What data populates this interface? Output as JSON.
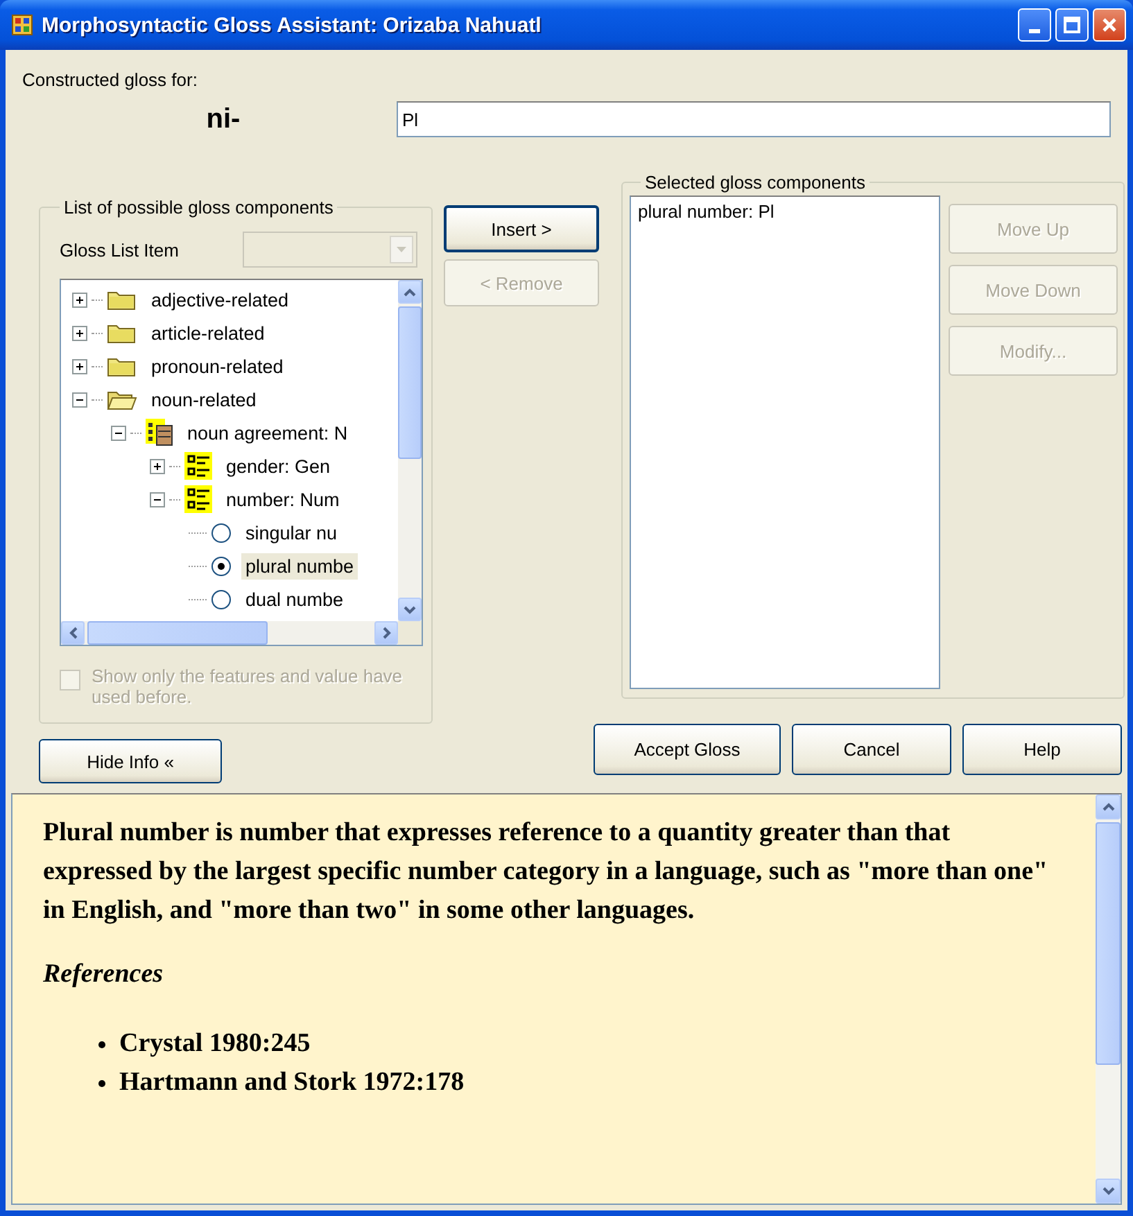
{
  "window": {
    "title": "Morphosyntactic Gloss Assistant: Orizaba Nahuatl"
  },
  "header": {
    "label": "Constructed gloss for:",
    "morpheme": "ni-",
    "gloss_value": "Pl"
  },
  "possible_components": {
    "title": "List of possible gloss components",
    "list_item_label": "Gloss List Item",
    "list_item_disabled": true,
    "tree": [
      {
        "kind": "folder",
        "label": "adjective-related",
        "expanded": false,
        "selected": false
      },
      {
        "kind": "folder",
        "label": "article-related",
        "expanded": false,
        "selected": false
      },
      {
        "kind": "folder",
        "label": "pronoun-related",
        "expanded": false,
        "selected": false
      },
      {
        "kind": "folder",
        "label": "noun-related",
        "expanded": true,
        "selected": false,
        "children": [
          {
            "kind": "group",
            "label": "noun agreement: N",
            "expanded": true,
            "selected": false,
            "children": [
              {
                "kind": "feature",
                "label": "gender: Gen",
                "expanded": false,
                "selected": false
              },
              {
                "kind": "feature",
                "label": "number: Num",
                "expanded": true,
                "selected": false,
                "children": [
                  {
                    "kind": "radio",
                    "label": "singular nu",
                    "selected": false
                  },
                  {
                    "kind": "radio",
                    "label": "plural numbe",
                    "selected": true
                  },
                  {
                    "kind": "radio",
                    "label": "dual numbe",
                    "selected": false
                  }
                ]
              }
            ]
          }
        ]
      }
    ],
    "filter_checkbox": {
      "label": "Show only the features and value have used before.",
      "checked": false,
      "disabled": true
    }
  },
  "transfer_buttons": [
    {
      "label": "Insert >",
      "disabled": false
    },
    {
      "label": "< Remove",
      "disabled": true
    }
  ],
  "selected_components": {
    "title": "Selected gloss components",
    "items": [
      "plural number: Pl"
    ],
    "buttons": [
      {
        "label": "Move Up",
        "disabled": true
      },
      {
        "label": "Move Down",
        "disabled": true
      },
      {
        "label": "Modify...",
        "disabled": true
      }
    ]
  },
  "hide_info_button": "Hide Info «",
  "dialog_buttons": [
    {
      "label": "Accept Gloss"
    },
    {
      "label": "Cancel"
    },
    {
      "label": "Help"
    }
  ],
  "info": {
    "paragraph": "Plural number is number that expresses reference to a quantity greater than that expressed by the largest specific number category in a language, such as \"more than one\" in English, and \"more than two\" in some other languages.",
    "references_heading": "References",
    "references": [
      "Crystal 1980:245",
      "Hartmann and Stork 1972:178"
    ]
  }
}
